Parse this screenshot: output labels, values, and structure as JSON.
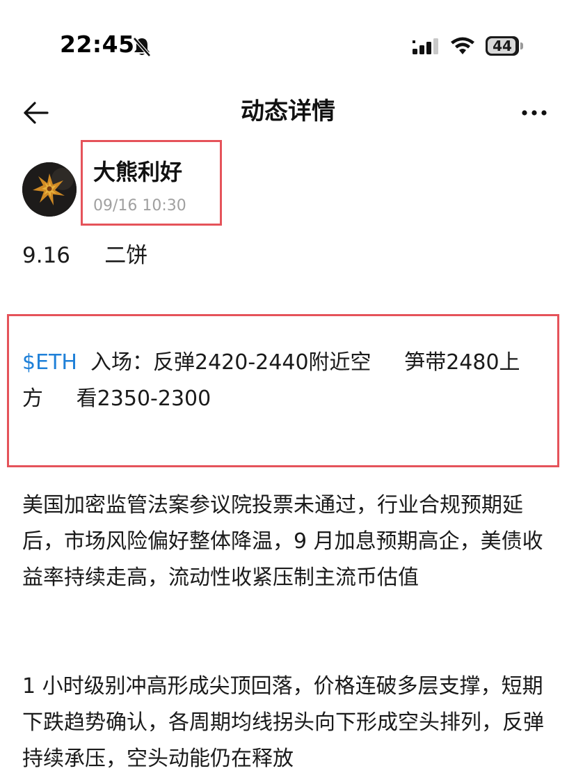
{
  "status_bar": {
    "time": "22:45",
    "battery": "44"
  },
  "nav": {
    "title": "动态详情"
  },
  "author": {
    "name": "大熊利好",
    "time": "09/16 10:30"
  },
  "post": {
    "date_line": "9.16     二饼",
    "trade": {
      "ticker": "$ETH",
      "line1_rest": "  入场：反弹2420-2440附近空     笋带2480上",
      "line2": "方     看2350-2300"
    },
    "paragraphs": [
      "美国加密监管法案参议院投票未通过，行业合规预期延后，市场风险偏好整体降温，9 月加息预期高企，美债收益率持续走高，流动性收紧压制主流币估值",
      "1 小时级别冲高形成尖顶回落，价格连破多层支撑，短期下跌趋势确认，各周期均线拐头向下形成空头排列，反弹持续承压，空头动能仍在释放"
    ]
  },
  "colors": {
    "highlight_border": "#e5535a",
    "ticker": "#1f80d8",
    "timestamp": "#a0a0a0"
  },
  "icons": {
    "back": "arrow-left-icon",
    "more": "more-dots-icon",
    "bell": "bell-off-icon",
    "signal": "cellular-signal-icon",
    "wifi": "wifi-icon",
    "battery": "battery-icon"
  }
}
